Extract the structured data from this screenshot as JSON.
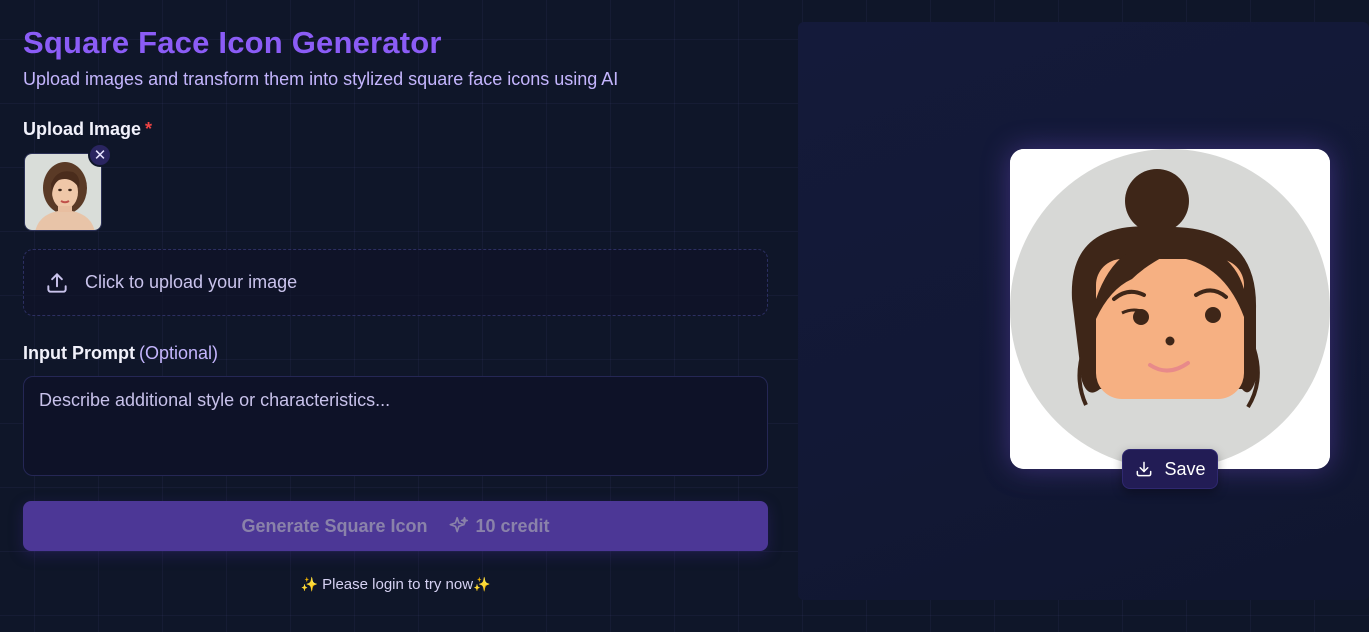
{
  "header": {
    "title": "Square Face Icon Generator",
    "subtitle": "Upload images and transform them into stylized square face icons using AI"
  },
  "upload": {
    "label": "Upload Image",
    "required_mark": "*",
    "remove_glyph": "✕",
    "dropzone_text": "Click to upload your image",
    "dropzone_icon": "upload-icon"
  },
  "prompt": {
    "label": "Input Prompt",
    "optional_label": "(Optional)",
    "placeholder": "Describe additional style or characteristics...",
    "value": ""
  },
  "generate": {
    "label": "Generate Square Icon",
    "credit": "10 credit",
    "icon": "sparkle-icon",
    "background": "#4c3796"
  },
  "login_note": {
    "text": "Please login to try now",
    "star": "✨"
  },
  "result": {
    "save_label": "Save",
    "save_icon": "download-icon"
  },
  "colors": {
    "accent": "#8b5cf6",
    "background": "#0f1629",
    "required": "#ef4444"
  }
}
